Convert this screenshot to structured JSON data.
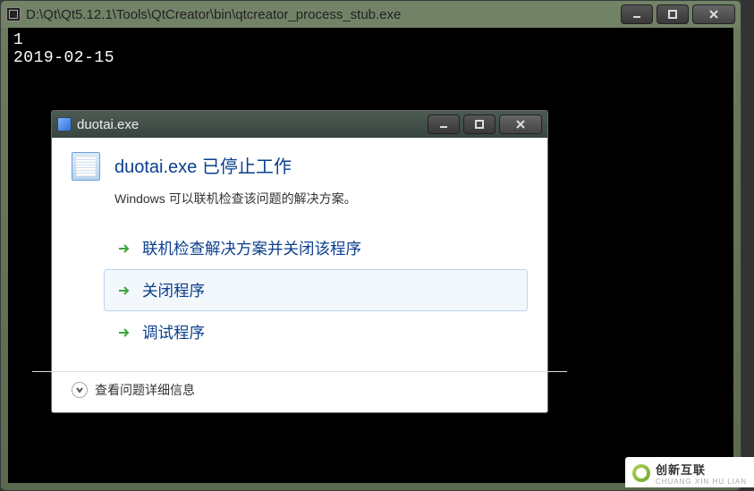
{
  "console_window": {
    "title": "D:\\Qt\\Qt5.12.1\\Tools\\QtCreator\\bin\\qtcreator_process_stub.exe",
    "lines": [
      "1",
      "2019-02-15"
    ]
  },
  "dialog": {
    "title": "duotai.exe",
    "headline": "duotai.exe 已停止工作",
    "subtext": "Windows 可以联机检查该问题的解决方案。",
    "actions": {
      "check_online": "联机检查解决方案并关闭该程序",
      "close_program": "关闭程序",
      "debug_program": "调试程序"
    },
    "details_label": "查看问题详细信息"
  },
  "watermark": {
    "cn": "创新互联",
    "py": "CHUANG XIN HU LIAN"
  }
}
